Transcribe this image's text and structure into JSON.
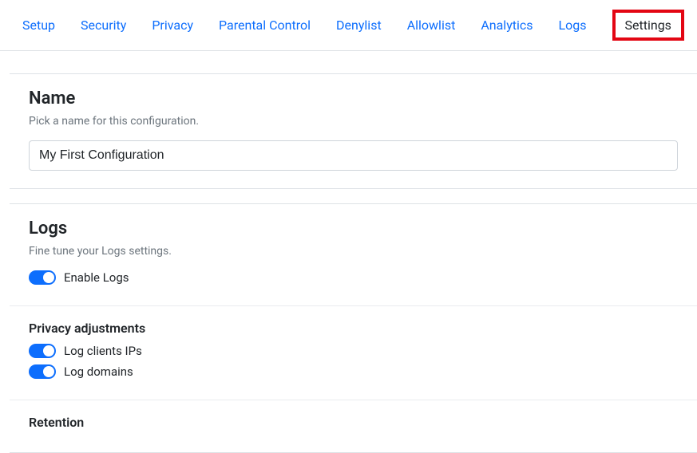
{
  "tabs": {
    "setup": "Setup",
    "security": "Security",
    "privacy": "Privacy",
    "parental_control": "Parental Control",
    "denylist": "Denylist",
    "allowlist": "Allowlist",
    "analytics": "Analytics",
    "logs": "Logs",
    "settings": "Settings"
  },
  "name_section": {
    "title": "Name",
    "subtitle": "Pick a name for this configuration.",
    "value": "My First Configuration"
  },
  "logs_section": {
    "title": "Logs",
    "subtitle": "Fine tune your Logs settings.",
    "enable_label": "Enable Logs",
    "enable_on": true,
    "privacy_title": "Privacy adjustments",
    "log_ips_label": "Log clients IPs",
    "log_ips_on": true,
    "log_domains_label": "Log domains",
    "log_domains_on": true,
    "retention_title": "Retention"
  }
}
